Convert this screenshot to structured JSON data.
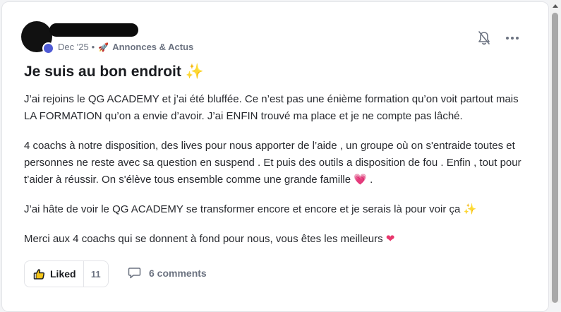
{
  "post": {
    "date": "Dec '25",
    "separator": "•",
    "category_icon": "rocket-icon",
    "category": "Annonces & Actus",
    "title": "Je suis au bon endroit",
    "title_emoji": "✨",
    "paragraphs": {
      "p1": "J’ai rejoins le QG ACADEMY et j’ai été bluffée. Ce n’est pas une énième formation qu’on voit partout mais LA FORMATION qu’on a envie d’avoir. J’ai ENFIN trouvé ma place et je ne compte pas lâché.",
      "p2": "4 coachs à notre disposition, des lives pour nous apporter de l’aide , un groupe où on s'entraide toutes et personnes ne reste avec sa question en suspend . Et puis des outils a disposition de fou . Enfin , tout pour t’aider à réussir. On s'élève tous ensemble comme une grande famille",
      "p2_emoji": "💗",
      "p2_end": " .",
      "p3": "J’ai hâte de voir le QG ACADEMY se transformer encore et encore et je serais là pour voir ça",
      "p3_emoji": "✨",
      "p4": "Merci aux 4 coachs qui se donnent à fond pour nous, vous êtes les meilleurs",
      "p4_emoji": "❤"
    }
  },
  "actions": {
    "like_label": "Liked",
    "like_count": "11",
    "comments_label": "6 comments"
  },
  "icons": {
    "notification": "bell-off-icon",
    "menu": "more-options-icon",
    "like": "thumbs-up-icon",
    "comment": "comment-bubble-icon"
  },
  "colors": {
    "accent_badge": "#4f5bd5",
    "heart": "#e8386d",
    "sparkle": "#f5c518",
    "muted_text": "#6b7280",
    "title_text": "#191b1f"
  }
}
